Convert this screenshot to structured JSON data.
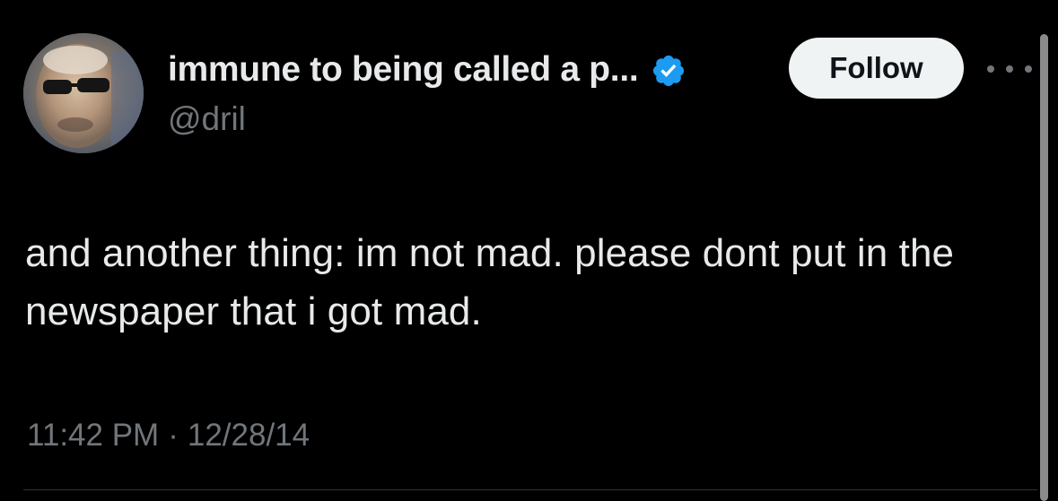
{
  "user": {
    "display_name": "immune to being called a p...",
    "handle": "@dril",
    "verified": true,
    "avatar_icon": "avatar-photo"
  },
  "follow_button": {
    "label": "Follow"
  },
  "more_menu": {
    "icon": "more-horizontal-icon"
  },
  "tweet": {
    "text": "and another thing: im not mad. please dont put in the newspaper that i got mad.",
    "time": "11:42 PM",
    "separator": "·",
    "date": "12/28/14"
  },
  "colors": {
    "background": "#000000",
    "primary_text": "#e7e9ea",
    "secondary_text": "#71767b",
    "verified_blue": "#1d9bf0",
    "follow_bg": "#eff3f4"
  }
}
